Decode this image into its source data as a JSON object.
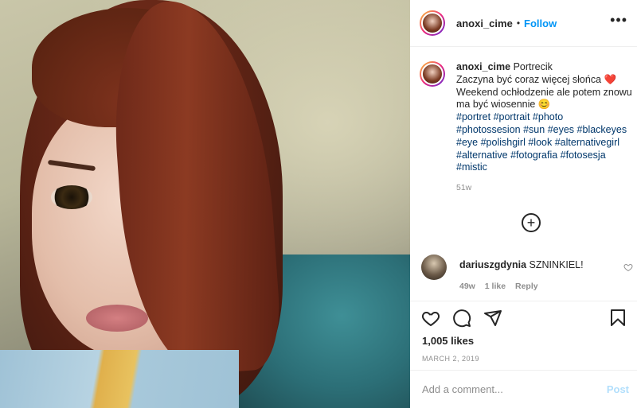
{
  "post": {
    "username": "anoxi_cime",
    "follow_separator": "•",
    "follow_label": "Follow",
    "more_label": "•••"
  },
  "caption": {
    "username": "anoxi_cime",
    "title": "Portrecik",
    "line1": "Zaczyna być coraz więcej słońca ❤️",
    "line2": "Weekend ochłodzenie ale potem znowu",
    "line3": "ma być wiosennie 😊",
    "hashtags": [
      [
        "#portret",
        "#portrait",
        "#photo"
      ],
      [
        "#photossesion",
        "#sun",
        "#eyes",
        "#blackeyes"
      ],
      [
        "#eye",
        "#polishgirl",
        "#look",
        "#alternativegirl"
      ],
      [
        "#alternative",
        "#fotografia",
        "#fotosesja"
      ],
      [
        "#mistic"
      ]
    ],
    "age": "51w"
  },
  "load_more": {
    "label": "+"
  },
  "comment": {
    "username": "dariuszgdynia",
    "text": "SZNINKIEL!",
    "age": "49w",
    "likes": "1 like",
    "reply": "Reply"
  },
  "actions": {
    "like_icon": "heart-icon",
    "comment_icon": "speech-bubble-icon",
    "share_icon": "paper-plane-icon",
    "save_icon": "bookmark-icon"
  },
  "stats": {
    "likes": "1,005 likes",
    "date": "MARCH 2, 2019"
  },
  "add_comment": {
    "placeholder": "Add a comment...",
    "post_label": "Post"
  },
  "colors": {
    "link_blue": "#0095f6",
    "hashtag": "#00376b",
    "muted": "#8e8e8e",
    "post_disabled": "#b2dffc"
  }
}
